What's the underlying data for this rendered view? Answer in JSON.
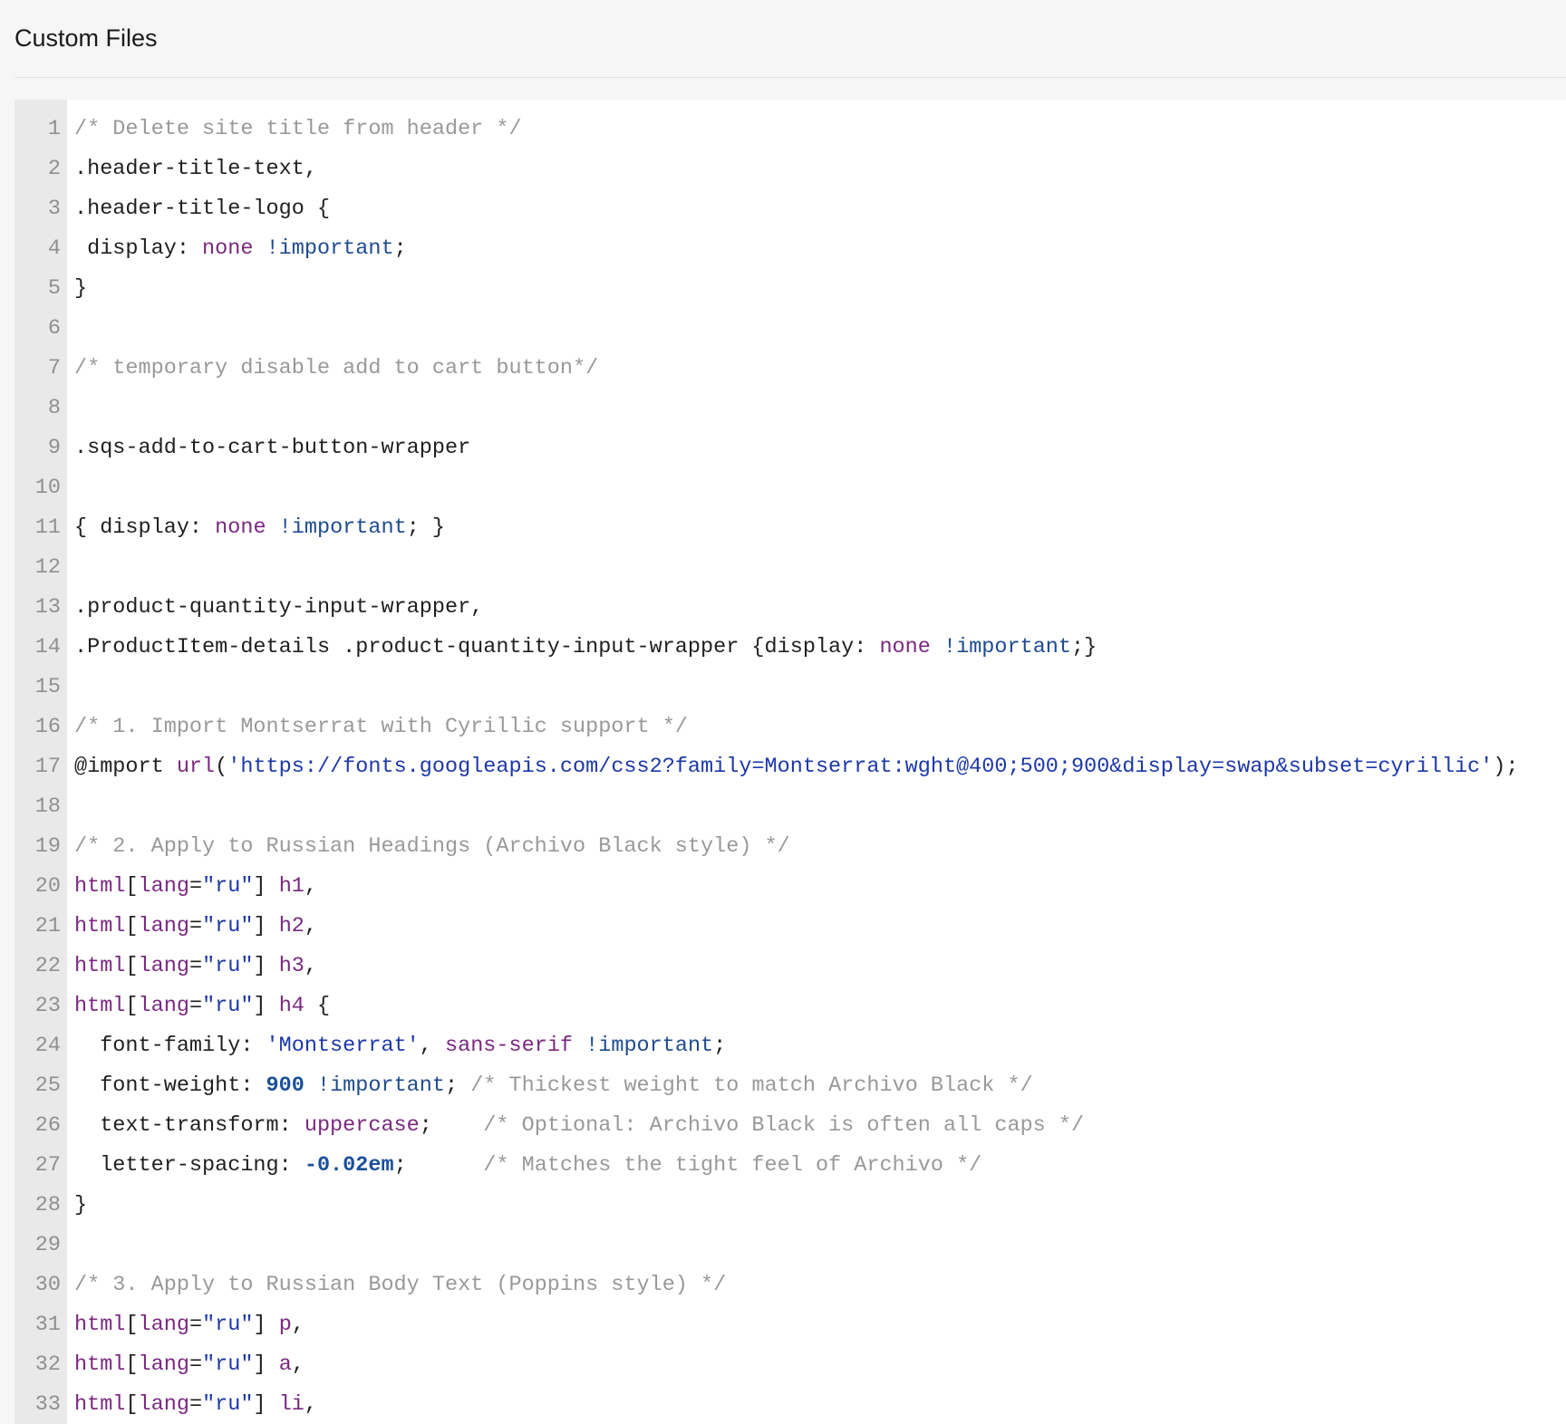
{
  "panel": {
    "title": "Custom Files"
  },
  "editor": {
    "lines": [
      {
        "n": "1",
        "tokens": [
          [
            "c",
            "/* Delete site title from header */"
          ]
        ]
      },
      {
        "n": "2",
        "tokens": [
          [
            "p",
            ".header-title-text,"
          ]
        ]
      },
      {
        "n": "3",
        "tokens": [
          [
            "p",
            ".header-title-logo {"
          ]
        ]
      },
      {
        "n": "4",
        "tokens": [
          [
            "p",
            " display: "
          ],
          [
            "k",
            "none"
          ],
          [
            "p",
            " "
          ],
          [
            "b",
            "!important"
          ],
          [
            "p",
            ";"
          ]
        ]
      },
      {
        "n": "5",
        "tokens": [
          [
            "p",
            "}"
          ]
        ]
      },
      {
        "n": "6",
        "tokens": []
      },
      {
        "n": "7",
        "tokens": [
          [
            "c",
            "/* temporary disable add to cart button*/"
          ]
        ]
      },
      {
        "n": "8",
        "tokens": []
      },
      {
        "n": "9",
        "tokens": [
          [
            "p",
            ".sqs-add-to-cart-button-wrapper"
          ]
        ]
      },
      {
        "n": "10",
        "tokens": []
      },
      {
        "n": "11",
        "tokens": [
          [
            "p",
            "{ display: "
          ],
          [
            "k",
            "none"
          ],
          [
            "p",
            " "
          ],
          [
            "b",
            "!important"
          ],
          [
            "p",
            "; }"
          ]
        ]
      },
      {
        "n": "12",
        "tokens": []
      },
      {
        "n": "13",
        "tokens": [
          [
            "p",
            ".product-quantity-input-wrapper,"
          ]
        ]
      },
      {
        "n": "14",
        "tokens": [
          [
            "p",
            ".ProductItem-details .product-quantity-input-wrapper {display: "
          ],
          [
            "k",
            "none"
          ],
          [
            "p",
            " "
          ],
          [
            "b",
            "!important"
          ],
          [
            "p",
            ";}"
          ]
        ]
      },
      {
        "n": "15",
        "tokens": []
      },
      {
        "n": "16",
        "tokens": [
          [
            "c",
            "/* 1. Import Montserrat with Cyrillic support */"
          ]
        ]
      },
      {
        "n": "17",
        "tokens": [
          [
            "p",
            "@import "
          ],
          [
            "k",
            "url"
          ],
          [
            "p",
            "("
          ],
          [
            "s",
            "'https://fonts.googleapis.com/css2?family=Montserrat:wght@400;500;900&display=swap&subset=cyrillic'"
          ],
          [
            "p",
            ");"
          ]
        ]
      },
      {
        "n": "18",
        "tokens": []
      },
      {
        "n": "19",
        "tokens": [
          [
            "c",
            "/* 2. Apply to Russian Headings (Archivo Black style) */"
          ]
        ]
      },
      {
        "n": "20",
        "tokens": [
          [
            "k",
            "html"
          ],
          [
            "p",
            "["
          ],
          [
            "k",
            "lang"
          ],
          [
            "p",
            "="
          ],
          [
            "s",
            "\"ru\""
          ],
          [
            "p",
            "] "
          ],
          [
            "k",
            "h1"
          ],
          [
            "p",
            ","
          ]
        ]
      },
      {
        "n": "21",
        "tokens": [
          [
            "k",
            "html"
          ],
          [
            "p",
            "["
          ],
          [
            "k",
            "lang"
          ],
          [
            "p",
            "="
          ],
          [
            "s",
            "\"ru\""
          ],
          [
            "p",
            "] "
          ],
          [
            "k",
            "h2"
          ],
          [
            "p",
            ","
          ]
        ]
      },
      {
        "n": "22",
        "tokens": [
          [
            "k",
            "html"
          ],
          [
            "p",
            "["
          ],
          [
            "k",
            "lang"
          ],
          [
            "p",
            "="
          ],
          [
            "s",
            "\"ru\""
          ],
          [
            "p",
            "] "
          ],
          [
            "k",
            "h3"
          ],
          [
            "p",
            ","
          ]
        ]
      },
      {
        "n": "23",
        "tokens": [
          [
            "k",
            "html"
          ],
          [
            "p",
            "["
          ],
          [
            "k",
            "lang"
          ],
          [
            "p",
            "="
          ],
          [
            "s",
            "\"ru\""
          ],
          [
            "p",
            "] "
          ],
          [
            "k",
            "h4"
          ],
          [
            "p",
            " {"
          ]
        ]
      },
      {
        "n": "24",
        "tokens": [
          [
            "p",
            "  font-family: "
          ],
          [
            "s",
            "'Montserrat'"
          ],
          [
            "p",
            ", "
          ],
          [
            "k",
            "sans-serif"
          ],
          [
            "p",
            " "
          ],
          [
            "b",
            "!important"
          ],
          [
            "p",
            ";"
          ]
        ]
      },
      {
        "n": "25",
        "tokens": [
          [
            "p",
            "  font-weight: "
          ],
          [
            "n",
            "900"
          ],
          [
            "p",
            " "
          ],
          [
            "b",
            "!important"
          ],
          [
            "p",
            "; "
          ],
          [
            "c",
            "/* Thickest weight to match Archivo Black */"
          ]
        ]
      },
      {
        "n": "26",
        "tokens": [
          [
            "p",
            "  text-transform: "
          ],
          [
            "k",
            "uppercase"
          ],
          [
            "p",
            ";    "
          ],
          [
            "c",
            "/* Optional: Archivo Black is often all caps */"
          ]
        ]
      },
      {
        "n": "27",
        "tokens": [
          [
            "p",
            "  letter-spacing: "
          ],
          [
            "n",
            "-0.02em"
          ],
          [
            "p",
            ";      "
          ],
          [
            "c",
            "/* Matches the tight feel of Archivo */"
          ]
        ]
      },
      {
        "n": "28",
        "tokens": [
          [
            "p",
            "}"
          ]
        ]
      },
      {
        "n": "29",
        "tokens": []
      },
      {
        "n": "30",
        "tokens": [
          [
            "c",
            "/* 3. Apply to Russian Body Text (Poppins style) */"
          ]
        ]
      },
      {
        "n": "31",
        "tokens": [
          [
            "k",
            "html"
          ],
          [
            "p",
            "["
          ],
          [
            "k",
            "lang"
          ],
          [
            "p",
            "="
          ],
          [
            "s",
            "\"ru\""
          ],
          [
            "p",
            "] "
          ],
          [
            "k",
            "p"
          ],
          [
            "p",
            ","
          ]
        ]
      },
      {
        "n": "32",
        "tokens": [
          [
            "k",
            "html"
          ],
          [
            "p",
            "["
          ],
          [
            "k",
            "lang"
          ],
          [
            "p",
            "="
          ],
          [
            "s",
            "\"ru\""
          ],
          [
            "p",
            "] "
          ],
          [
            "k",
            "a"
          ],
          [
            "p",
            ","
          ]
        ]
      },
      {
        "n": "33",
        "tokens": [
          [
            "k",
            "html"
          ],
          [
            "p",
            "["
          ],
          [
            "k",
            "lang"
          ],
          [
            "p",
            "="
          ],
          [
            "s",
            "\"ru\""
          ],
          [
            "p",
            "] "
          ],
          [
            "k",
            "li"
          ],
          [
            "p",
            ","
          ]
        ]
      }
    ]
  }
}
